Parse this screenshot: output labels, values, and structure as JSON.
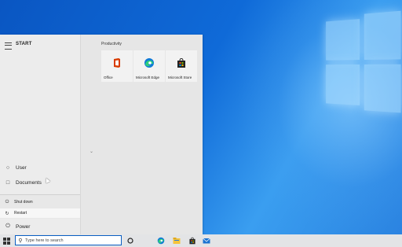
{
  "start_menu": {
    "title": "START",
    "rail": {
      "user": "User",
      "documents": "Documents",
      "power": "Power"
    },
    "power_flyout": {
      "shut_down": "Shut down",
      "restart": "Restart"
    },
    "group": {
      "label": "Productivity",
      "tiles": [
        {
          "label": "Office",
          "icon": "office-icon"
        },
        {
          "label": "Microsoft Edge",
          "icon": "edge-icon"
        },
        {
          "label": "Microsoft Store",
          "icon": "store-icon"
        }
      ]
    }
  },
  "taskbar": {
    "search_placeholder": "Type here to search",
    "pinned": [
      "task-view-icon",
      "edge-icon",
      "file-explorer-icon",
      "store-icon",
      "mail-icon"
    ]
  },
  "colors": {
    "accent": "#0a5ec2",
    "office": "#d83b01",
    "edge": "#0f7bd6",
    "desktop": "#0f6ad8"
  }
}
